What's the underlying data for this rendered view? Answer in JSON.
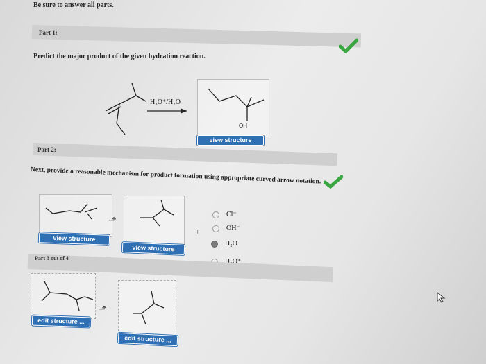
{
  "header": {
    "instruction": "Be sure to answer all parts."
  },
  "part1": {
    "label": "Part 1:",
    "question": "Predict the major product of the given hydration reaction.",
    "reagent": "H₃O⁺/H₂O",
    "oh_label": "OH",
    "view_button": "view structure"
  },
  "part2": {
    "label": "Part 2:",
    "question": "Next, provide a reasonable mechanism for product formation using appropriate curved arrow notation.",
    "view_button_left": "view structure",
    "view_button_mid": "view structure",
    "plus": "+",
    "options": [
      {
        "label": "Cl⁻",
        "selected": false
      },
      {
        "label": "OH⁻",
        "selected": false
      },
      {
        "label": "H₂O",
        "selected": true
      },
      {
        "label": "H₃O⁺",
        "selected": false
      }
    ]
  },
  "part3": {
    "label": "Part 3 out of 4",
    "edit_button_left": "edit structure ...",
    "edit_button_mid": "edit structure ..."
  },
  "colors": {
    "check": "#3aa641",
    "button": "#2f6fb3"
  }
}
